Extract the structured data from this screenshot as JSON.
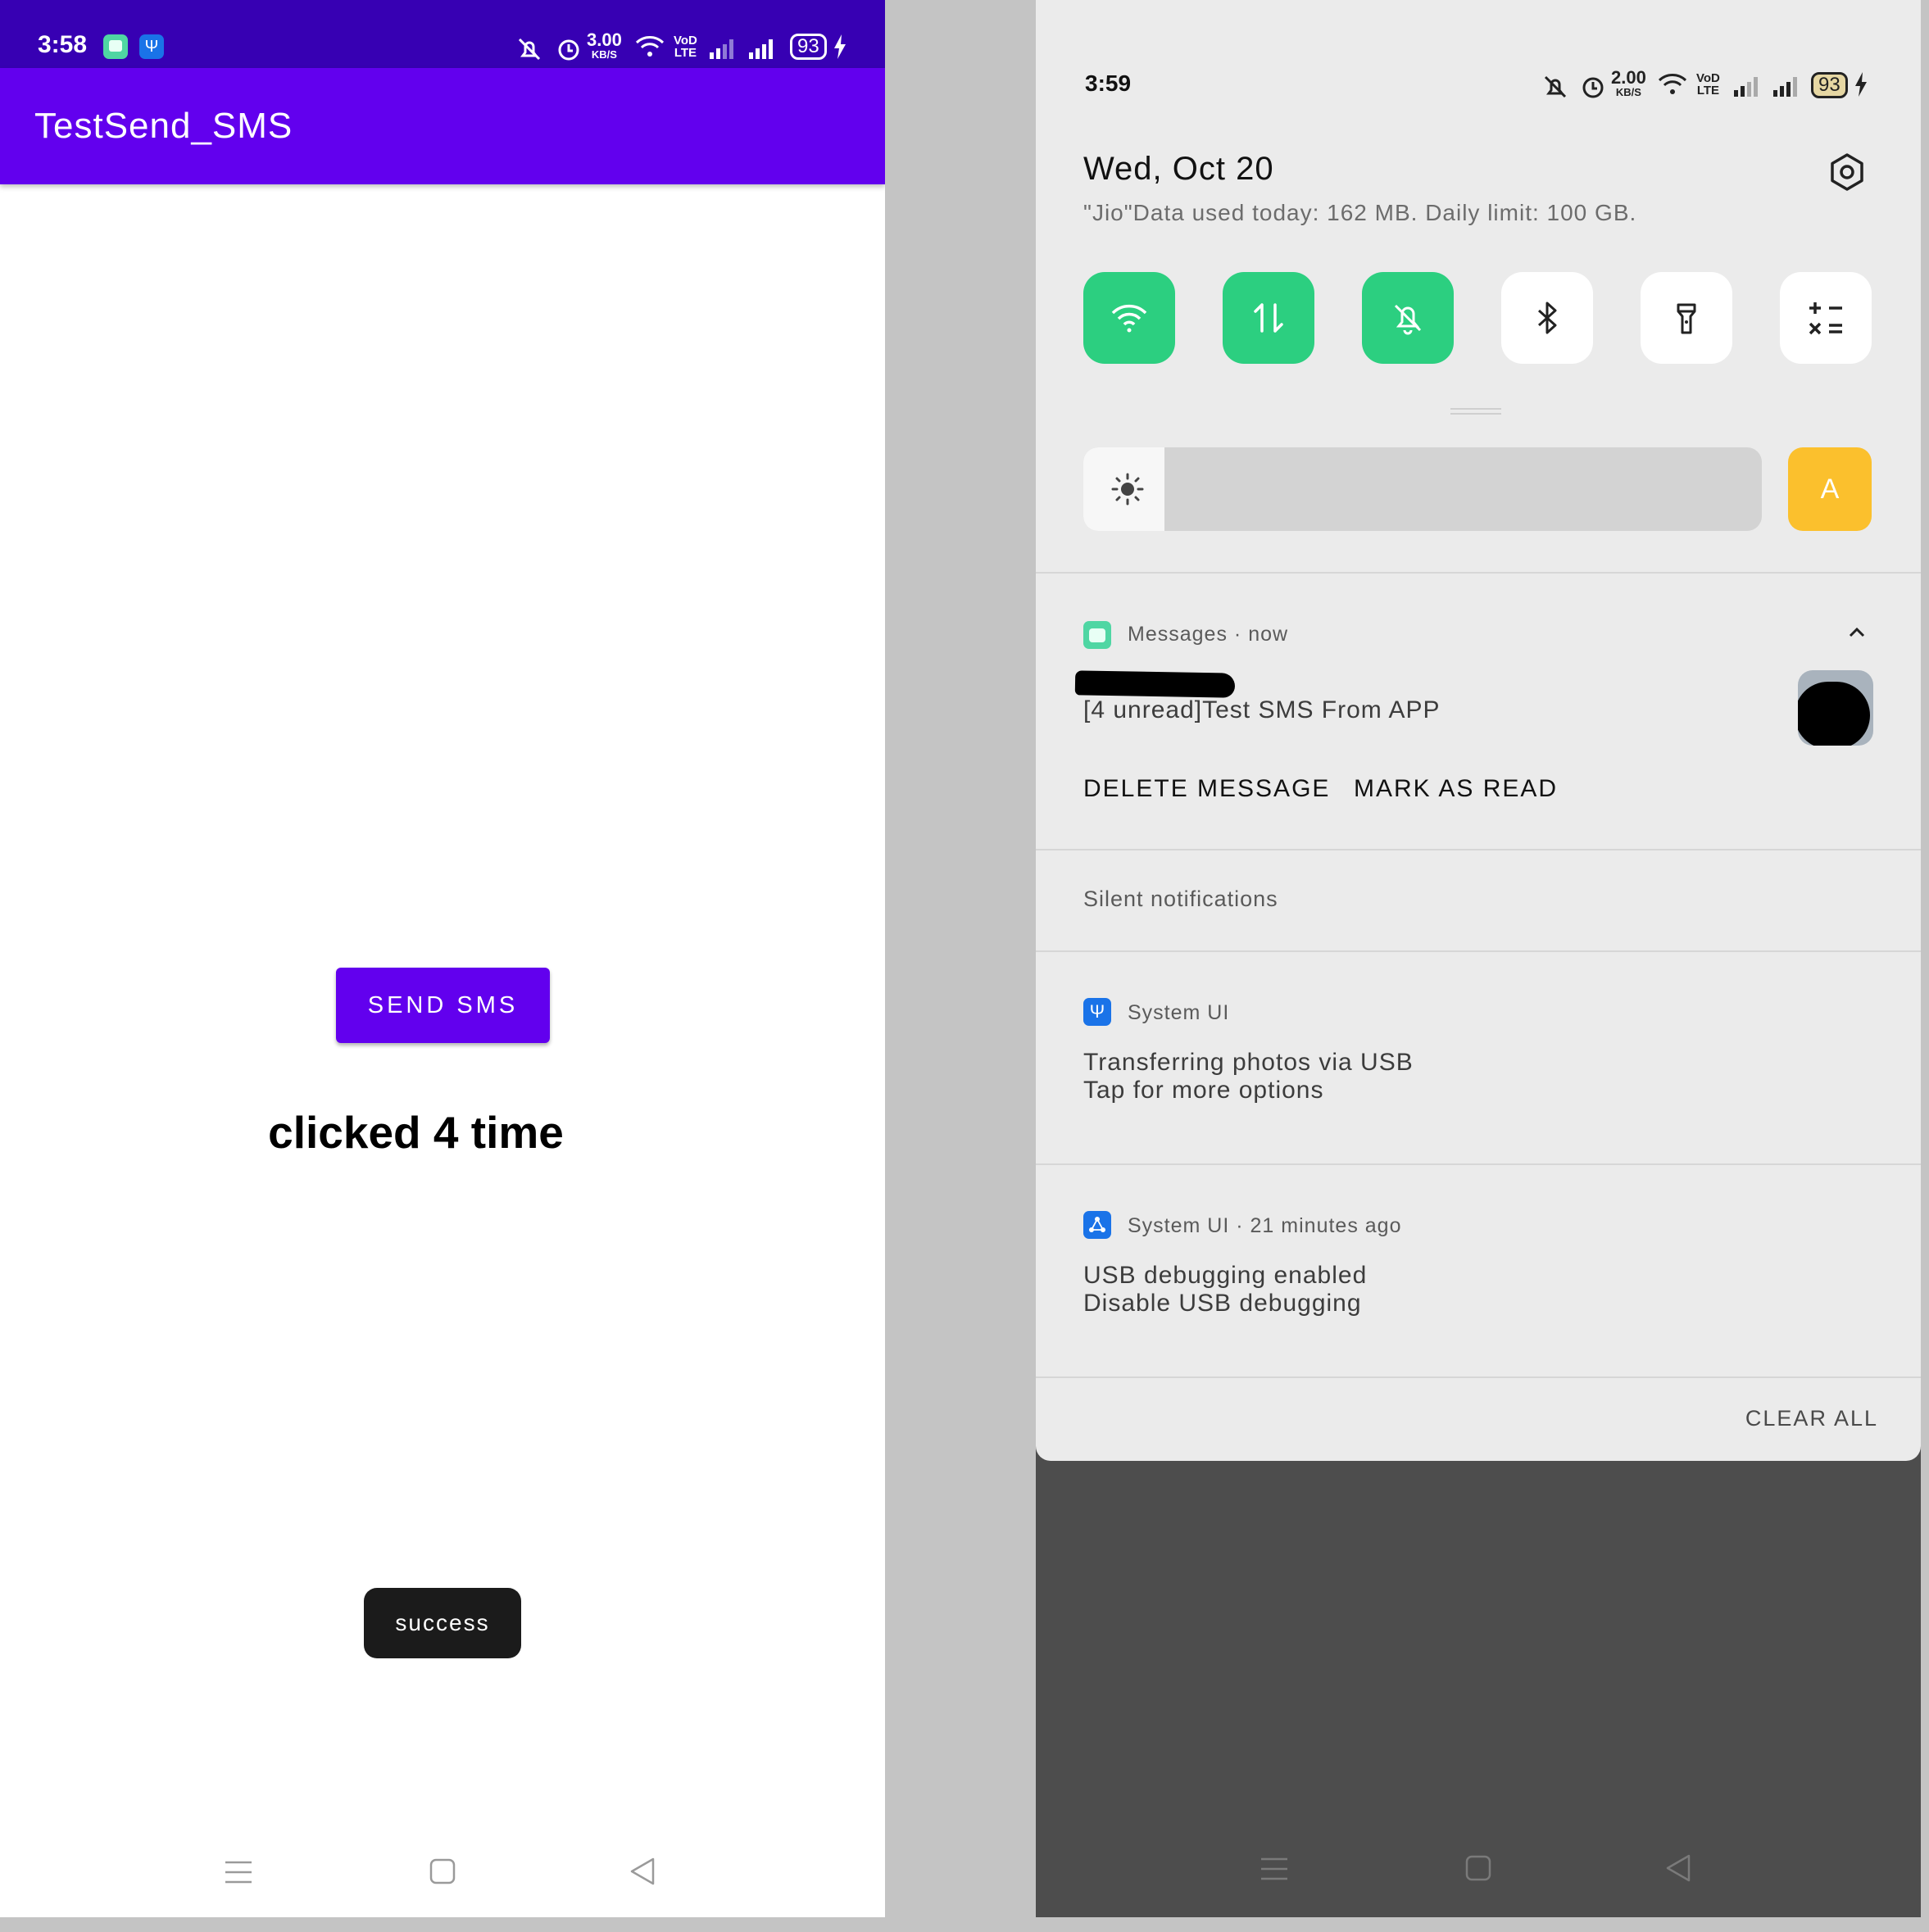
{
  "left_phone": {
    "status_bar": {
      "time": "3:58",
      "net_speed_value": "3.00",
      "net_speed_unit": "KB/S",
      "volte_top": "VoD",
      "volte_bottom": "LTE",
      "battery": "93"
    },
    "app_bar": {
      "title": "TestSend_SMS"
    },
    "content": {
      "send_button_label": "SEND SMS",
      "counter_text": "clicked 4 time",
      "toast_text": "success"
    }
  },
  "right_phone": {
    "status_bar": {
      "time": "3:59",
      "net_speed_value": "2.00",
      "net_speed_unit": "KB/S",
      "volte_top": "VoD",
      "volte_bottom": "LTE",
      "battery": "93"
    },
    "header": {
      "date": "Wed, Oct 20",
      "data_usage": "\"Jio\"Data used today: 162 MB. Daily limit: 100 GB."
    },
    "quick_tiles": [
      {
        "icon": "wifi-icon",
        "state": "on"
      },
      {
        "icon": "mobile-data-icon",
        "state": "on"
      },
      {
        "icon": "silent-bell-icon",
        "state": "on"
      },
      {
        "icon": "bluetooth-icon",
        "state": "off"
      },
      {
        "icon": "flashlight-icon",
        "state": "off"
      },
      {
        "icon": "calculator-icon",
        "state": "off"
      }
    ],
    "brightness": {
      "level": 0.12,
      "auto_label": "A"
    },
    "messages_notification": {
      "app": "Messages",
      "time": "now",
      "text": "[4 unread]Test SMS From APP",
      "action_delete": "DELETE MESSAGE",
      "action_read": "MARK AS READ"
    },
    "silent_header": "Silent notifications",
    "usb_notification": {
      "app": "System UI",
      "line1": "Transferring photos via USB",
      "line2": "Tap for more options"
    },
    "debug_notification": {
      "app": "System UI",
      "time": "21 minutes ago",
      "line1": "USB debugging enabled",
      "line2": "Disable USB debugging"
    },
    "clear_all": "CLEAR ALL"
  },
  "colors": {
    "primary": "#6200ee",
    "primary_dark": "#3700b3",
    "tile_on": "#2ccf80",
    "auto_brightness": "#fbc02d",
    "notif_icon_blue": "#1a73e8"
  }
}
